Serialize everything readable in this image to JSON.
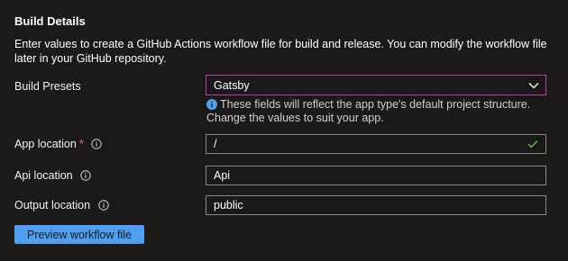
{
  "section": {
    "title": "Build Details",
    "description": "Enter values to create a GitHub Actions workflow file for build and release. You can modify the workflow file later in your GitHub repository."
  },
  "build_presets": {
    "label": "Build Presets",
    "selected": "Gatsby",
    "hint": "These fields will reflect the app type's default project structure. Change the values to suit your app."
  },
  "app_location": {
    "label": "App location",
    "required_marker": "*",
    "value": "/"
  },
  "api_location": {
    "label": "Api location",
    "value": "Api"
  },
  "output_location": {
    "label": "Output location",
    "value": "public"
  },
  "actions": {
    "preview_label": "Preview workflow file"
  },
  "colors": {
    "background": "#1b1a19",
    "accent_button": "#4f9ff0",
    "dropdown_focus_border": "#c239b3",
    "valid_check": "#6ccb5f",
    "required": "#f1707b",
    "info_blue": "#4f9ff0"
  }
}
